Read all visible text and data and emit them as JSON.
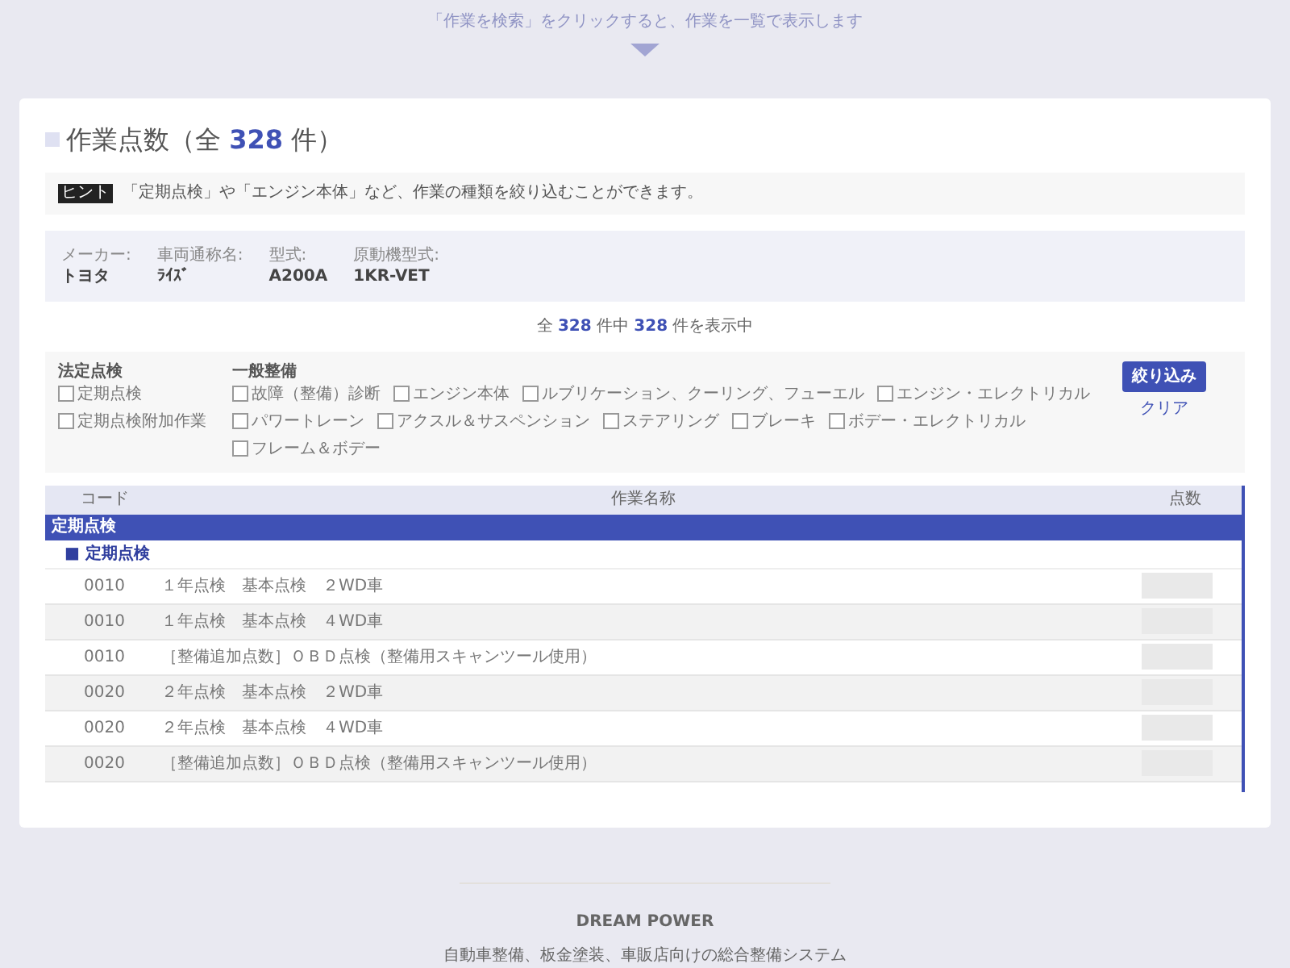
{
  "top_hint": "「作業を検索」をクリックすると、作業を一覧で表示します",
  "title": "作業点数（全 **328** 件）",
  "tip": {
    "badge": "ヒント",
    "text": "「定期点検」や「エンジン本体」など、作業の種類を絞り込むことができます。"
  },
  "vehicle": [
    {
      "label": "メーカー:",
      "value": "トヨタ"
    },
    {
      "label": "車両通称名:",
      "value": "ﾗｲｽﾞ"
    },
    {
      "label": "型式:",
      "value": "A200A"
    },
    {
      "label": "原動機型式:",
      "value": "1KR-VET"
    }
  ],
  "count": "全 **328** 件中 **328** 件を表示中",
  "filters": [
    {
      "heading": "法定点検",
      "options": [
        {
          "label": "定期点検",
          "checked": false
        },
        {
          "label": "定期点検附加作業",
          "checked": false
        }
      ]
    },
    {
      "heading": "一般整備",
      "options": [
        {
          "label": "故障（整備）診断",
          "checked": false
        },
        {
          "label": "エンジン本体",
          "checked": false
        },
        {
          "label": "ルブリケーション、クーリング、フューエル",
          "checked": false
        },
        {
          "label": "エンジン・エレクトリカル",
          "checked": false
        },
        {
          "label": "パワートレーン",
          "checked": false
        },
        {
          "label": "アクスル＆サスペンション",
          "checked": false
        },
        {
          "label": "ステアリング",
          "checked": false
        },
        {
          "label": "ブレーキ",
          "checked": false
        },
        {
          "label": "ボデー・エレクトリカル",
          "checked": false
        },
        {
          "label": "フレーム＆ボデー",
          "checked": false
        }
      ]
    }
  ],
  "filter_button": "絞り込み",
  "clear_link": "クリア",
  "table": {
    "columns": [
      "コード",
      "作業名称",
      "点数"
    ],
    "group": "定期点検",
    "subgroup": "■ 定期点検",
    "rows": [
      {
        "code": "0010",
        "name": "１年点検　基本点検　２WD車"
      },
      {
        "code": "0010",
        "name": "１年点検　基本点検　４WD車"
      },
      {
        "code": "0010",
        "name": "［整備追加点数］ＯＢＤ点検（整備用スキャンツール使用）"
      },
      {
        "code": "0020",
        "name": "２年点検　基本点検　２WD車"
      },
      {
        "code": "0020",
        "name": "２年点検　基本点検　４WD車"
      },
      {
        "code": "0020",
        "name": "［整備追加点数］ＯＢＤ点検（整備用スキャンツール使用）"
      }
    ]
  },
  "footer": {
    "brand": "DREAM POWER",
    "tagline": "自動車整備、板金塗装、車販店向けの総合整備システム"
  }
}
